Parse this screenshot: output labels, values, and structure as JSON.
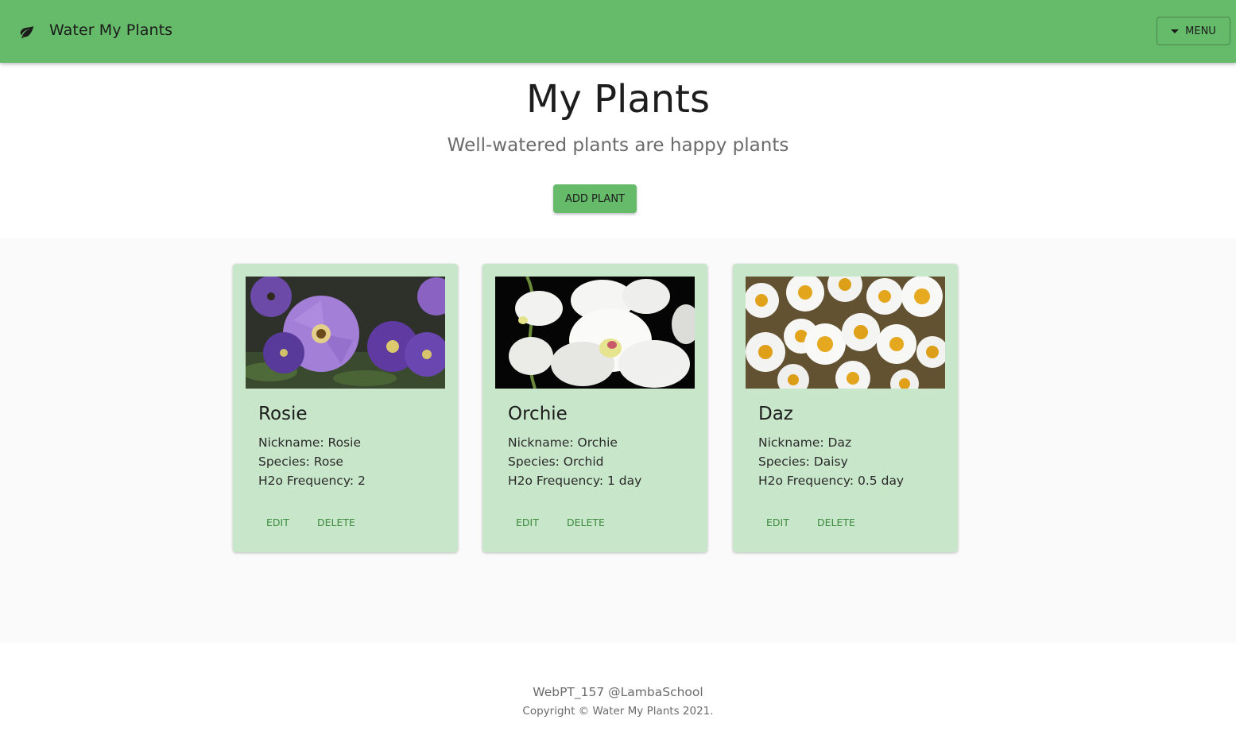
{
  "header": {
    "brand_icon": "leaf-icon",
    "brand_title": "Water My Plants",
    "menu_label": "MENU",
    "menu_icon": "caret-down-icon",
    "bar_color": "#66bb6a"
  },
  "hero": {
    "title": "My Plants",
    "subtitle": "Well-watered plants are happy plants",
    "add_label": "ADD PLANT"
  },
  "plants": [
    {
      "name": "Rosie",
      "nickname": "Nickname: Rosie",
      "species": "Species: Rose",
      "frequency": "H2o Frequency: 2",
      "photo": "purple-petunia-photo",
      "edit_label": "EDIT",
      "delete_label": "DELETE"
    },
    {
      "name": "Orchie",
      "nickname": "Nickname: Orchie",
      "species": "Species: Orchid",
      "frequency": "H2o Frequency: 1 day",
      "photo": "white-orchid-photo",
      "edit_label": "EDIT",
      "delete_label": "DELETE"
    },
    {
      "name": "Daz",
      "nickname": "Nickname: Daz",
      "species": "Species: Daisy",
      "frequency": "H2o Frequency: 0.5 day",
      "photo": "daisies-photo",
      "edit_label": "EDIT",
      "delete_label": "DELETE"
    }
  ],
  "footer": {
    "line1": "WebPT_157 @LambaSchool",
    "line2": "Copyright © Water My Plants 2021."
  },
  "colors": {
    "card_bg": "#c8e6c9",
    "action_text": "#3d8b40",
    "section_bg": "#fafafa"
  }
}
